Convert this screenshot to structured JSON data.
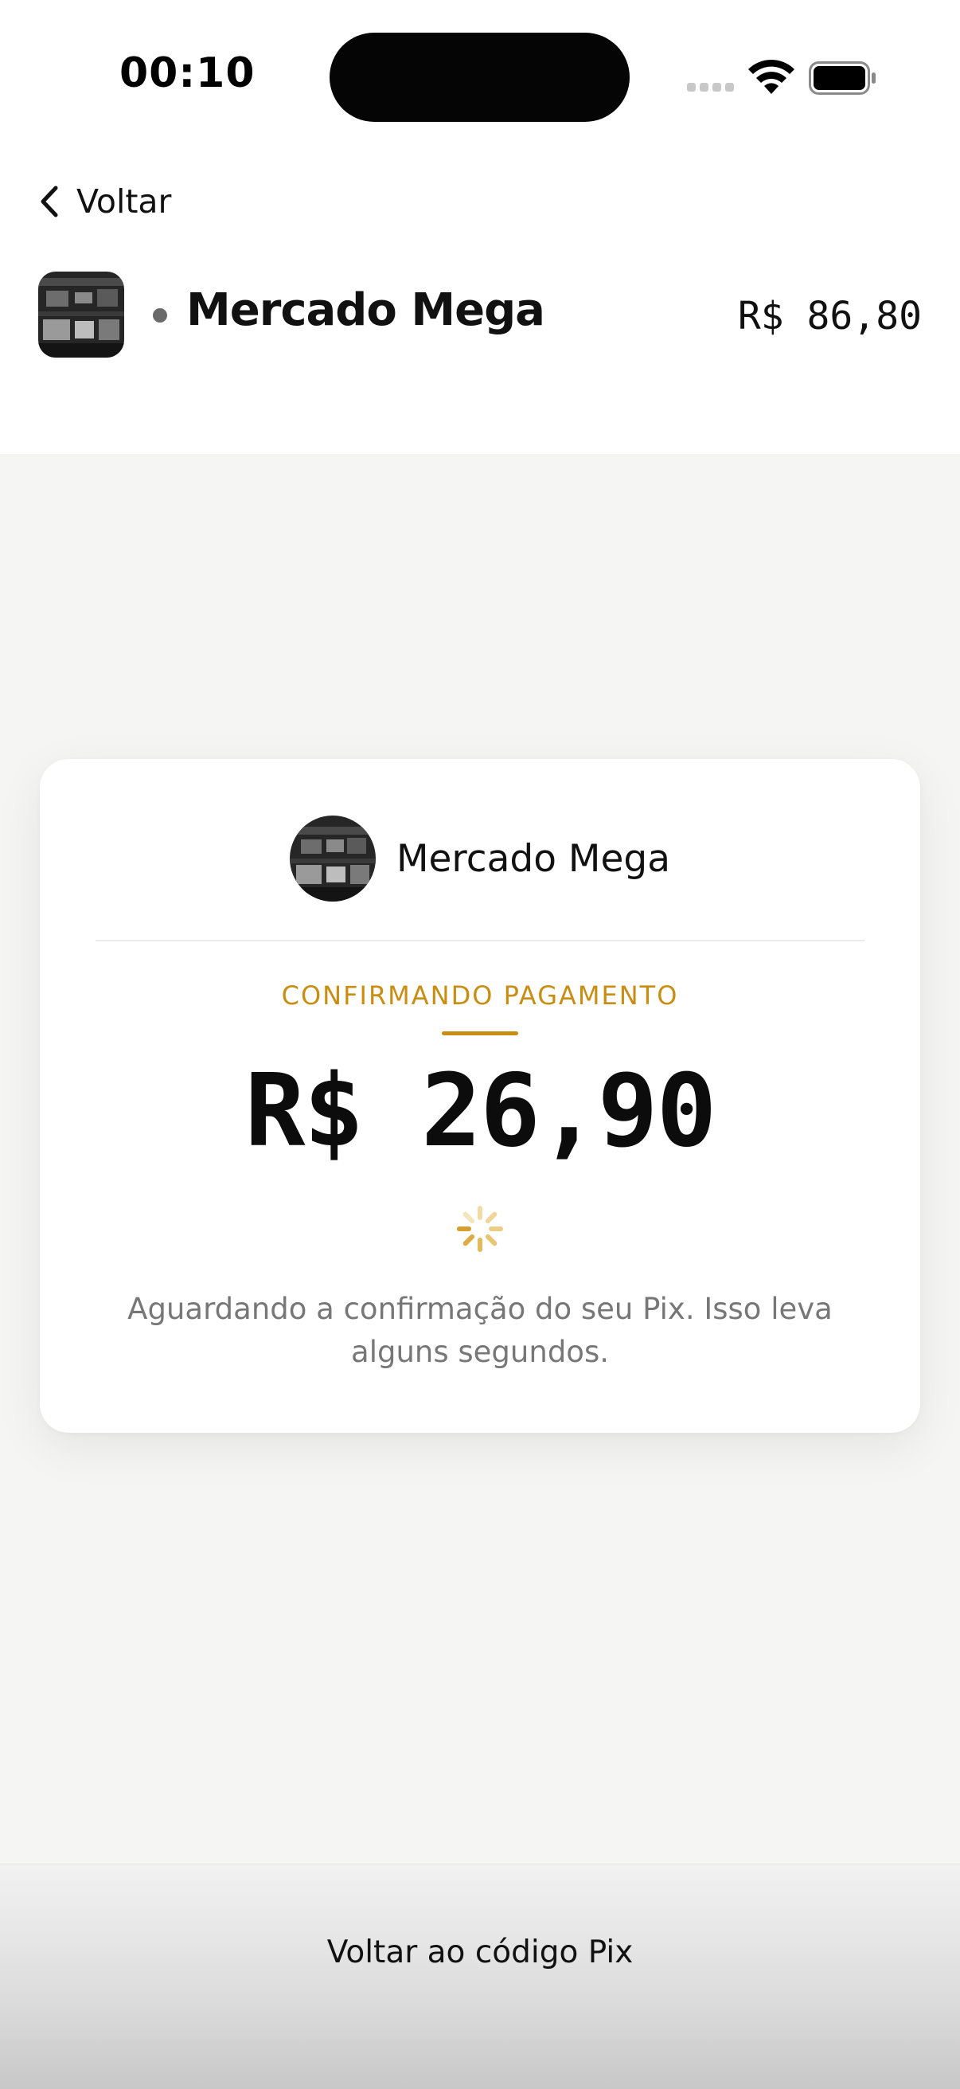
{
  "status_bar": {
    "time": "00:10"
  },
  "nav": {
    "back_label": "Voltar"
  },
  "header": {
    "store_name": "Mercado Mega",
    "total_amount": "R$ 86,80"
  },
  "card": {
    "store_name": "Mercado Mega",
    "status_label": "CONFIRMANDO PAGAMENTO",
    "amount": "R$ 26,90",
    "message": "Aguardando a confirmação do seu Pix. Isso leva alguns segundos."
  },
  "footer": {
    "button_label": "Voltar ao código Pix"
  },
  "colors": {
    "accent": "#c98d12",
    "background": "#f5f5f4",
    "card": "#ffffff",
    "text": "#111111",
    "muted_text": "#777777"
  },
  "icons": {
    "back": "chevron-left-icon",
    "spinner": "loading-spinner-icon",
    "wifi": "wifi-icon",
    "battery": "battery-icon",
    "signal": "cell-signal-icon"
  }
}
